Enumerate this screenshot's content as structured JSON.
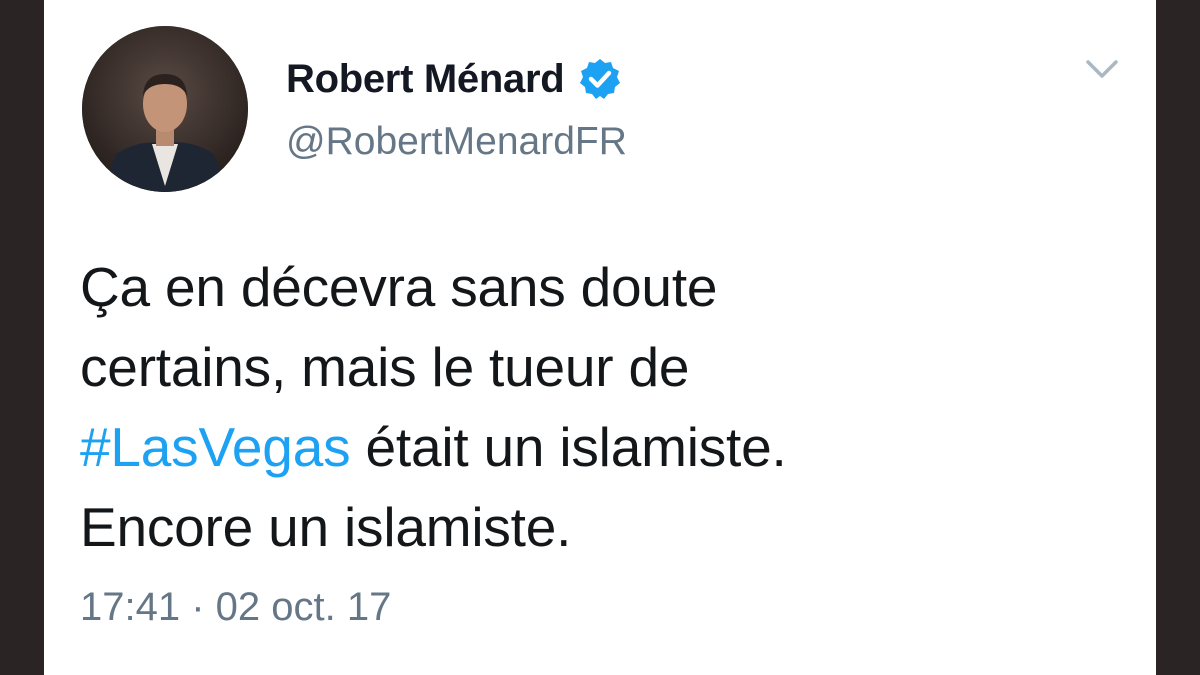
{
  "tweet": {
    "author": {
      "display_name": "Robert Ménard",
      "handle": "@RobertMenardFR",
      "verified": true,
      "avatar_icon": "profile-photo"
    },
    "text": {
      "line1": "Ça en décevra sans doute",
      "line2": "certains, mais le tueur de",
      "line3_hashtag": "#LasVegas",
      "line3_rest": " était un islamiste.",
      "line4": "Encore un islamiste."
    },
    "timestamp": "17:41 · 02 oct. 17",
    "menu_icon": "chevron-down-icon"
  },
  "colors": {
    "background_frame": "#2a2524",
    "card": "#ffffff",
    "hashtag": "#1da1f2",
    "verified_badge": "#1da1f2",
    "secondary_text": "#657786",
    "primary_text": "#14171a"
  }
}
